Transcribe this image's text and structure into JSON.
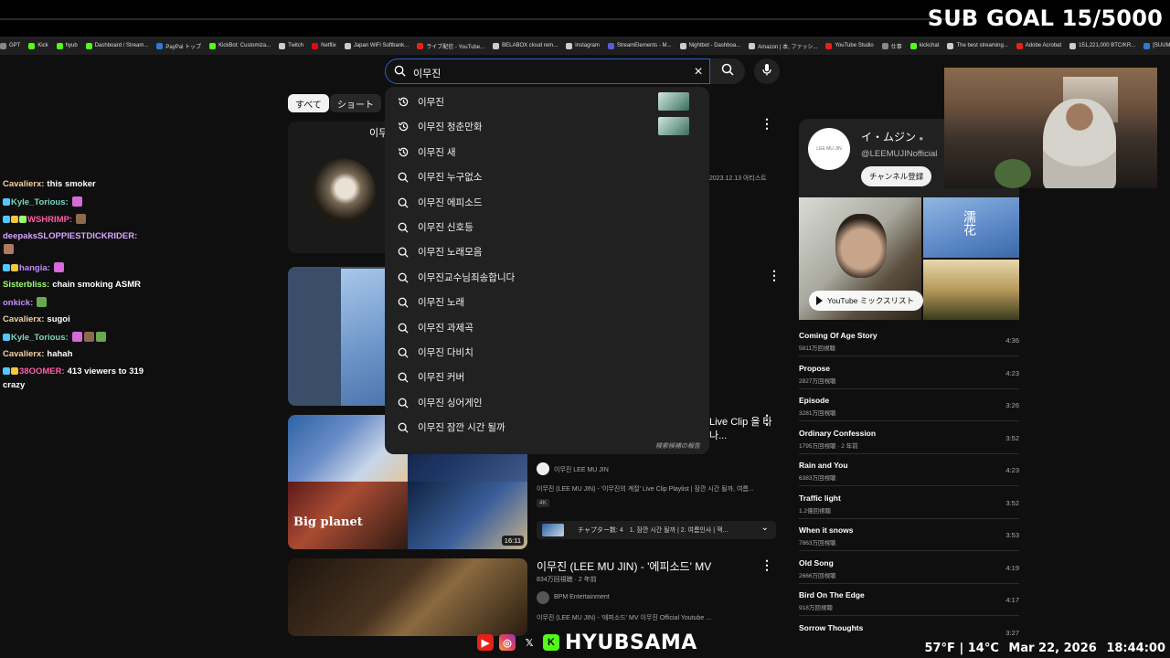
{
  "overlay": {
    "sub_goal": "SUB GOAL 15/5000",
    "handle": "HYUBSAMA",
    "weather": "57°F | 14°C",
    "date": "Mar 22, 2026",
    "time": "18:44:00"
  },
  "bookmarks": [
    {
      "label": "GPT",
      "color": "#888888"
    },
    {
      "label": "Kick",
      "color": "#53fc18"
    },
    {
      "label": "hyub",
      "color": "#53fc18"
    },
    {
      "label": "Dashboard / Stream...",
      "color": "#53fc18"
    },
    {
      "label": "PayPal トップ",
      "color": "#2d7bd6"
    },
    {
      "label": "KickBot: Customiza...",
      "color": "#53fc18"
    },
    {
      "label": "Twitch",
      "color": "#cccccc"
    },
    {
      "label": "Netflix",
      "color": "#e50914"
    },
    {
      "label": "Japan WiFi Softbank...",
      "color": "#cccccc"
    },
    {
      "label": "ライブ配信 - YouTube...",
      "color": "#e62117"
    },
    {
      "label": "BELABOX cloud rem...",
      "color": "#cccccc"
    },
    {
      "label": "Instagram",
      "color": "#cccccc"
    },
    {
      "label": "StreamElements - M...",
      "color": "#5b5bd6"
    },
    {
      "label": "Nightbot - Dashboa...",
      "color": "#cccccc"
    },
    {
      "label": "Amazon | 本, ファッシ...",
      "color": "#cccccc"
    },
    {
      "label": "YouTube Studio",
      "color": "#e62117"
    },
    {
      "label": "仕事",
      "color": "#888888"
    },
    {
      "label": "kickchat",
      "color": "#53fc18"
    },
    {
      "label": "The best streaming...",
      "color": "#cccccc"
    },
    {
      "label": "Adobe Acrobat",
      "color": "#e62117"
    },
    {
      "label": "151,221,000 BTC/KR...",
      "color": "#cccccc"
    },
    {
      "label": "[SUUMO] U R B I",
      "color": "#2d7bd6"
    }
  ],
  "search": {
    "query": "이무진",
    "clear_icon": "×"
  },
  "filters": {
    "all": "すべて",
    "shorts": "ショート"
  },
  "suggestions": [
    {
      "text": "이무진",
      "icon": "history",
      "thumb": true
    },
    {
      "text": "이무진 청춘만화",
      "icon": "history",
      "thumb": true
    },
    {
      "text": "이무진 새",
      "icon": "history",
      "thumb": false
    },
    {
      "text": "이무진 누구없소",
      "icon": "search",
      "thumb": false
    },
    {
      "text": "이무진 에피소드",
      "icon": "search",
      "thumb": false
    },
    {
      "text": "이무진 신호등",
      "icon": "search",
      "thumb": false
    },
    {
      "text": "이무진 노래모음",
      "icon": "search",
      "thumb": false
    },
    {
      "text": "이무진교수님죄송합니다",
      "icon": "search",
      "thumb": false
    },
    {
      "text": "이무진 노래",
      "icon": "search",
      "thumb": false
    },
    {
      "text": "이무진 과제곡",
      "icon": "search",
      "thumb": false
    },
    {
      "text": "이무진 다비치",
      "icon": "search",
      "thumb": false
    },
    {
      "text": "이무진 커버",
      "icon": "search",
      "thumb": false
    },
    {
      "text": "이무진 싱어게인",
      "icon": "search",
      "thumb": false
    },
    {
      "text": "이무진 잠깐 시간 될까",
      "icon": "search",
      "thumb": false
    }
  ],
  "suggest_report": "検索候補の報告",
  "results": {
    "top_title": "이무",
    "top_date": "2023.12.13 아티스트",
    "mix": {
      "title": "Live Clip 을 타나...",
      "watermark": "Big planet",
      "duration": "16:11",
      "channel": "이무진 LEE MU JIN",
      "desc": "이무진 (LEE MU JIN) - '이무진의 계절' Live Clip Playlist | 잠깐 시간 될까, 여름...",
      "badge": "4K",
      "chapters": "チャプター数: 4　1. 잠깐 시간 될까 | 2. 여름인사 | 잭..."
    },
    "episode": {
      "title": "이무진 (LEE MU JIN) - '에피소드' MV",
      "meta": "834万回視聴 · 2 年前",
      "channel": "BPM Entertainment",
      "desc": "이무진 (LEE MU JIN) - '에피소드' MV 이무진 Official Youtube ..."
    }
  },
  "channel": {
    "name": "イ・ムジン",
    "handle": "@LEEMUJINofficial",
    "subscribe": "チャンネル登録",
    "avatar_text": "LEE MU JIN",
    "mix_button": "YouTube ミックスリスト",
    "kanji": "濡花"
  },
  "songs": [
    {
      "title": "Coming Of Age Story",
      "views": "5811万回視聴",
      "duration": "4:36"
    },
    {
      "title": "Propose",
      "views": "2827万回視聴",
      "duration": "4:23"
    },
    {
      "title": "Episode",
      "views": "3281万回視聴",
      "duration": "3:26"
    },
    {
      "title": "Ordinary Confession",
      "views": "1795万回視聴 · 2 年前",
      "duration": "3:52"
    },
    {
      "title": "Rain and You",
      "views": "6383万回視聴",
      "duration": "4:23"
    },
    {
      "title": "Traffic light",
      "views": "1.2億回視聴",
      "duration": "3:52"
    },
    {
      "title": "When it snows",
      "views": "7863万回視聴",
      "duration": "3:53"
    },
    {
      "title": "Old Song",
      "views": "2666万回視聴",
      "duration": "4:19"
    },
    {
      "title": "Bird On The Edge",
      "views": "918万回視聴",
      "duration": "4:17"
    },
    {
      "title": "Sorrow Thoughts",
      "views": "",
      "duration": "3:27"
    }
  ],
  "chat": [
    {
      "user": "Cavalierx:",
      "color": "#f5d3a4",
      "text": "this smoker",
      "emotes": 0,
      "badges": 0
    },
    {
      "user": "Kyle_Torious:",
      "color": "#7dd3c0",
      "text": "",
      "emotes": 1,
      "badges": 1
    },
    {
      "user": "WSHRIMP:",
      "color": "#ff5ca8",
      "text": "",
      "emotes": 1,
      "badges": 3
    },
    {
      "user": "deepaksSLOPPIESTDICKRIDER:",
      "color": "#d9a5ff",
      "text": "",
      "emotes": 0,
      "badges": 0
    },
    {
      "user": "",
      "color": "#ffffff",
      "text": "",
      "emotes": 1,
      "badges": 0
    },
    {
      "user": "hangia:",
      "color": "#c58cff",
      "text": "",
      "emotes": 1,
      "badges": 2
    },
    {
      "user": "Sisterbliss:",
      "color": "#9cff6e",
      "text": "chain smoking ASMR",
      "emotes": 0,
      "badges": 0
    },
    {
      "user": "onkick:",
      "color": "#c58cff",
      "text": "",
      "emotes": 1,
      "badges": 0
    },
    {
      "user": "Cavalierx:",
      "color": "#f5d3a4",
      "text": "sugoi",
      "emotes": 0,
      "badges": 0
    },
    {
      "user": "Kyle_Torious:",
      "color": "#7dd3c0",
      "text": "",
      "emotes": 3,
      "badges": 1
    },
    {
      "user": "Cavalierx:",
      "color": "#f5d3a4",
      "text": "hahah",
      "emotes": 0,
      "badges": 0
    },
    {
      "user": "38OOMER:",
      "color": "#ff5ca8",
      "text": "413 viewers to 319",
      "emotes": 0,
      "badges": 2
    },
    {
      "user": "",
      "color": "#ffffff",
      "text": "crazy",
      "emotes": 0,
      "badges": 0
    }
  ]
}
